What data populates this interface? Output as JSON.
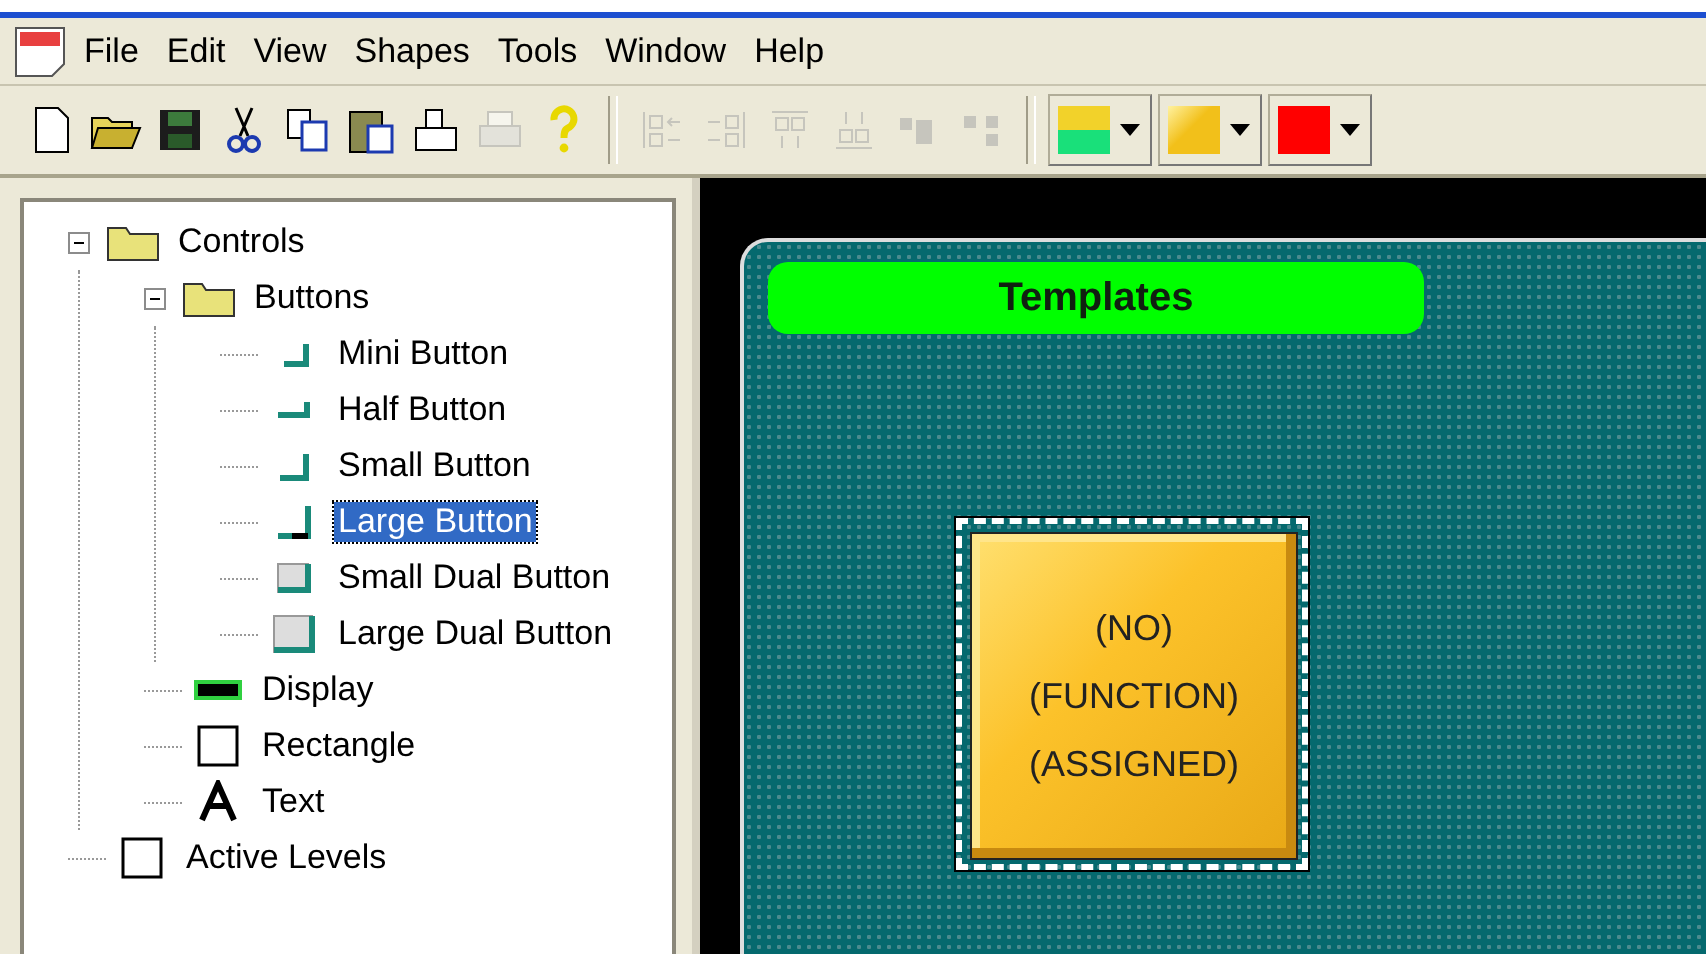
{
  "menu": [
    "File",
    "Edit",
    "View",
    "Shapes",
    "Tools",
    "Window",
    "Help"
  ],
  "toolbar": {
    "buttons": [
      {
        "kind": "new",
        "disabled": false
      },
      {
        "kind": "open",
        "disabled": false
      },
      {
        "kind": "save",
        "disabled": false
      },
      {
        "kind": "cut",
        "disabled": false
      },
      {
        "kind": "copy",
        "disabled": false
      },
      {
        "kind": "paste",
        "disabled": false
      },
      {
        "kind": "print-setup",
        "disabled": false
      },
      {
        "kind": "print",
        "disabled": true
      },
      {
        "kind": "help",
        "disabled": false
      },
      {
        "kind": "align-left",
        "disabled": true
      },
      {
        "kind": "align-right",
        "disabled": true
      },
      {
        "kind": "align-top",
        "disabled": true
      },
      {
        "kind": "align-bottom",
        "disabled": true
      },
      {
        "kind": "group",
        "disabled": true
      },
      {
        "kind": "ungroup",
        "disabled": true
      }
    ],
    "color_pickers": [
      {
        "kind": "split",
        "color": "#f2d22a"
      },
      {
        "kind": "gradient",
        "color": "#f2c01a"
      },
      {
        "kind": "solid",
        "color": "#ff0000"
      }
    ]
  },
  "tree": [
    {
      "label": "Controls",
      "kind": "folder",
      "expanded": true,
      "selected": false,
      "children": [
        {
          "label": "Buttons",
          "kind": "folder",
          "expanded": true,
          "selected": false,
          "children": [
            {
              "label": "Mini Button",
              "kind": "mini",
              "selected": false
            },
            {
              "label": "Half Button",
              "kind": "half",
              "selected": false
            },
            {
              "label": "Small Button",
              "kind": "small",
              "selected": false
            },
            {
              "label": "Large Button",
              "kind": "large",
              "selected": true
            },
            {
              "label": "Small Dual Button",
              "kind": "small-dual",
              "selected": false
            },
            {
              "label": "Large Dual Button",
              "kind": "large-dual",
              "selected": false
            }
          ]
        },
        {
          "label": "Display",
          "kind": "display",
          "selected": false
        },
        {
          "label": "Rectangle",
          "kind": "rectangle",
          "selected": false
        },
        {
          "label": "Text",
          "kind": "text",
          "selected": false
        }
      ]
    },
    {
      "label": "Active Levels",
      "kind": "rectangle",
      "selected": false
    }
  ],
  "canvas": {
    "title": "Templates",
    "button": {
      "label": "(NO)\n(FUNCTION)\n(ASSIGNED)",
      "selected": true
    }
  }
}
